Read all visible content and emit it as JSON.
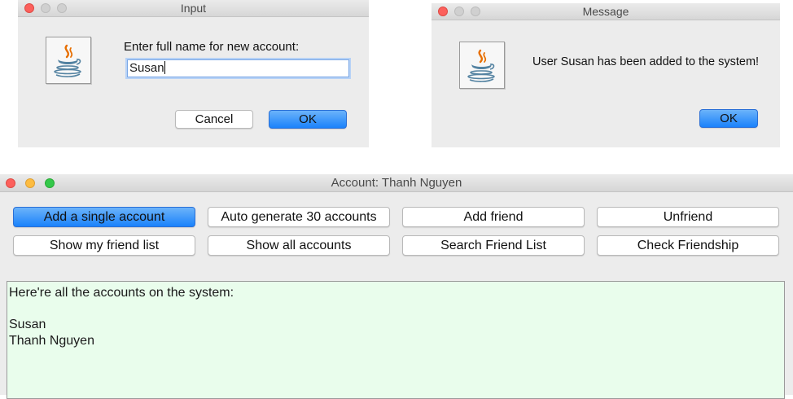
{
  "input_dialog": {
    "title": "Input",
    "prompt": "Enter full name for new account:",
    "field_value": "Susan",
    "cancel_label": "Cancel",
    "ok_label": "OK"
  },
  "message_dialog": {
    "title": "Message",
    "message": "User Susan has been added to the system!",
    "ok_label": "OK"
  },
  "main_window": {
    "title": "Account: Thanh Nguyen",
    "buttons": [
      {
        "label": "Add a single account",
        "active": true
      },
      {
        "label": "Auto generate 30 accounts",
        "active": false
      },
      {
        "label": "Add friend",
        "active": false
      },
      {
        "label": "Unfriend",
        "active": false
      },
      {
        "label": "Show my friend list",
        "active": false
      },
      {
        "label": "Show all accounts",
        "active": false
      },
      {
        "label": "Search Friend List",
        "active": false
      },
      {
        "label": "Check Friendship",
        "active": false
      }
    ],
    "output_lines": [
      "Here're all the accounts on the system:",
      "",
      "Susan",
      "Thanh Nguyen"
    ]
  },
  "colors": {
    "accent_blue": "#1a82fb",
    "output_background": "#e9fdec",
    "close_red": "#fc605c",
    "minimize_yellow": "#fdbc40",
    "zoom_green": "#34c84a"
  }
}
